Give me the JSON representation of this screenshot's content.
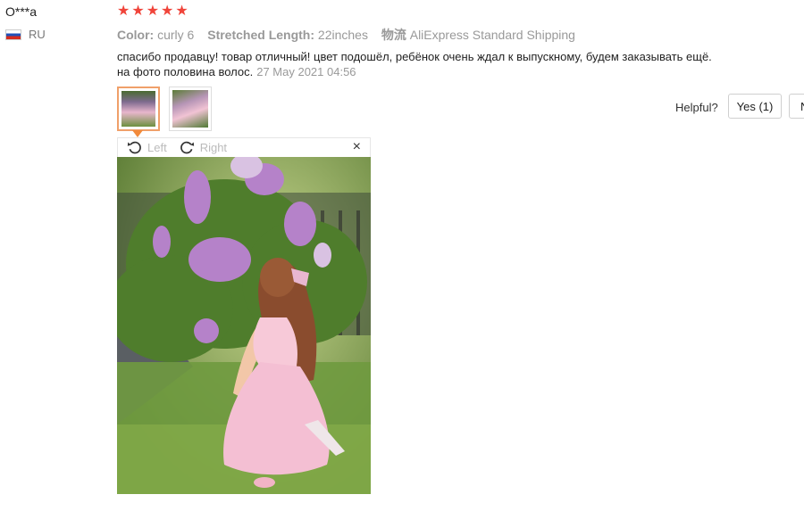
{
  "reviewer": {
    "name": "O***a",
    "country_code": "RU",
    "flag_icon": "russia-flag-icon"
  },
  "rating": {
    "stars": 5,
    "max": 5,
    "color": "#f0443a"
  },
  "attributes": [
    {
      "label": "Color:",
      "value": "curly 6"
    },
    {
      "label": "Stretched Length:",
      "value": "22inches"
    },
    {
      "label": "物流",
      "value": "AliExpress Standard Shipping"
    }
  ],
  "review": {
    "line1": "спасибо продавцу! товар отличный! цвет подошёл, ребёнок очень ждал к выпускному, будем заказывать ещё.",
    "line2": "на фото половина волос.",
    "date": "27 May 2021 04:56"
  },
  "thumbnails": [
    {
      "name": "photo-thumbnail-1",
      "active": true
    },
    {
      "name": "photo-thumbnail-2",
      "active": false
    }
  ],
  "viewer": {
    "rotate_left_label": "Left",
    "rotate_right_label": "Right",
    "close_symbol": "×",
    "accent_color": "#f28a3a"
  },
  "helpful": {
    "label": "Helpful?",
    "yes_label": "Yes (1)",
    "no_label": "N"
  }
}
